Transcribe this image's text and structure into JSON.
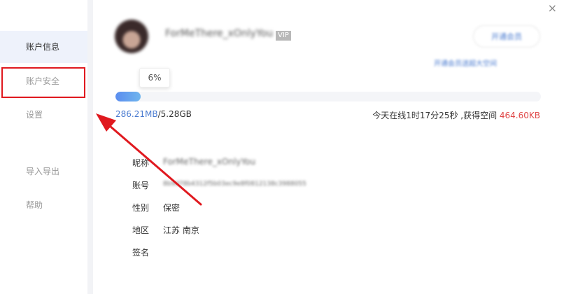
{
  "sidebar": {
    "items": [
      {
        "label": "账户信息"
      },
      {
        "label": "账户安全"
      },
      {
        "label": "设置"
      },
      {
        "label": "导入导出"
      },
      {
        "label": "帮助"
      }
    ]
  },
  "window": {
    "close_label": "×"
  },
  "profile": {
    "nickname": "ForMeThere_xOnlyYou",
    "vip_label": "VIP",
    "open_vip_button": "开通会员",
    "promo_text": "开通会员送超大空间"
  },
  "storage": {
    "percent_label": "6%",
    "percent_value": 6,
    "used": "286.21MB",
    "total": "/5.28GB",
    "online_text": "今天在线1时17分25秒 ,获得空间 ",
    "gained": "464.60KB"
  },
  "info": {
    "nickname_label": "昵称",
    "nickname_value": "ForMeThere_xOnlyYou",
    "account_label": "账号",
    "account_value": "8b9d78b4312f5b03ec9e8f0812138c3988055",
    "gender_label": "性别",
    "gender_value": "保密",
    "region_label": "地区",
    "region_value": "江苏 南京",
    "signature_label": "签名"
  },
  "colors": {
    "accent": "#4a7bd0",
    "highlight": "#e0191f",
    "gain": "#e04848"
  }
}
